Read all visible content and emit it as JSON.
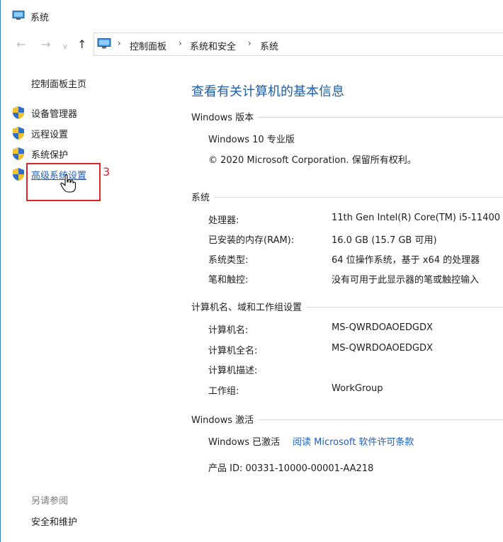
{
  "window": {
    "title": "系统"
  },
  "addressbar": {
    "crumbs": [
      "控制面板",
      "系统和安全",
      "系统"
    ]
  },
  "sidebar": {
    "home": "控制面板主页",
    "items": [
      {
        "label": "设备管理器"
      },
      {
        "label": "远程设置"
      },
      {
        "label": "系统保护"
      },
      {
        "label": "高级系统设置"
      }
    ],
    "see_also": "另请参阅",
    "see_also_items": [
      "安全和维护"
    ]
  },
  "annotation": {
    "step": "3",
    "color": "#e0252a"
  },
  "main": {
    "title": "查看有关计算机的基本信息",
    "windows_edition": {
      "header": "Windows 版本",
      "edition": "Windows 10 专业版",
      "copyright": "© 2020 Microsoft Corporation. 保留所有权利。"
    },
    "system": {
      "header": "系统",
      "rows": [
        {
          "key": "处理器:",
          "value": "11th Gen Intel(R) Core(TM) i5-11400"
        },
        {
          "key": "已安装的内存(RAM):",
          "value": "16.0 GB (15.7 GB 可用)"
        },
        {
          "key": "系统类型:",
          "value": "64 位操作系统，基于 x64 的处理器"
        },
        {
          "key": "笔和触控:",
          "value": "没有可用于此显示器的笔或触控输入"
        }
      ]
    },
    "computer": {
      "header": "计算机名、域和工作组设置",
      "rows": [
        {
          "key": "计算机名:",
          "value": "MS-QWRDOAOEDGDX"
        },
        {
          "key": "计算机全名:",
          "value": "MS-QWRDOAOEDGDX"
        },
        {
          "key": "计算机描述:",
          "value": ""
        },
        {
          "key": "工作组:",
          "value": "WorkGroup"
        }
      ]
    },
    "activation": {
      "header": "Windows 激活",
      "status": "Windows 已激活",
      "license_link": "阅读 Microsoft 软件许可条款",
      "product_id": "产品 ID: 00331-10000-00001-AA218"
    }
  },
  "colors": {
    "link": "#1f5fbf",
    "title": "#1f5da8",
    "accent_border": "#3b7fd1"
  }
}
